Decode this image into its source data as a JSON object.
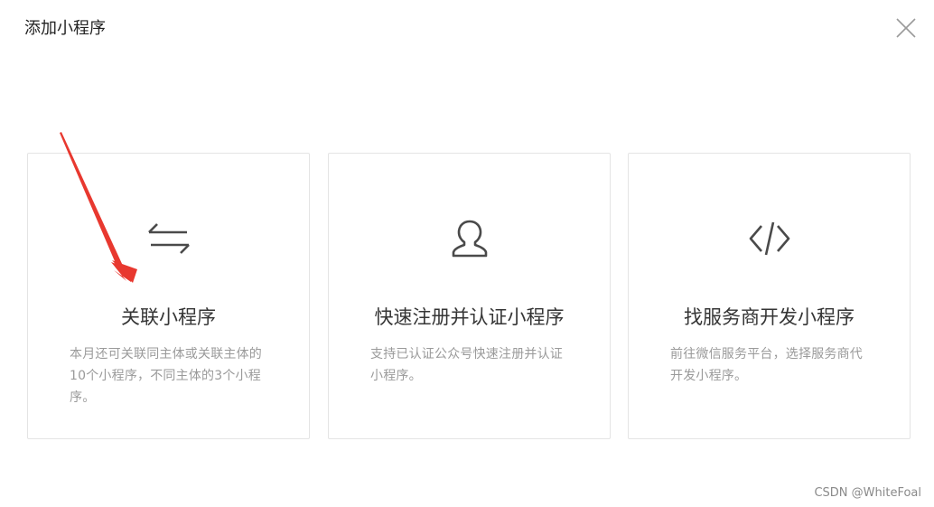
{
  "dialog": {
    "title": "添加小程序",
    "close_icon": "close-icon"
  },
  "cards": [
    {
      "icon": "transfer-arrows-icon",
      "title": "关联小程序",
      "description": "本月还可关联同主体或关联主体的10个小程序，不同主体的3个小程序。"
    },
    {
      "icon": "user-icon",
      "title": "快速注册并认证小程序",
      "description": "支持已认证公众号快速注册并认证小程序。"
    },
    {
      "icon": "code-icon",
      "title": "找服务商开发小程序",
      "description": "前往微信服务平台，选择服务商代开发小程序。"
    }
  ],
  "annotation": {
    "arrow_color": "#e8382f"
  },
  "watermark": "CSDN @WhiteFoal",
  "colors": {
    "card_border": "#e4e4e4",
    "icon": "#4a4a4a",
    "desc_text": "#9a9a9a"
  }
}
